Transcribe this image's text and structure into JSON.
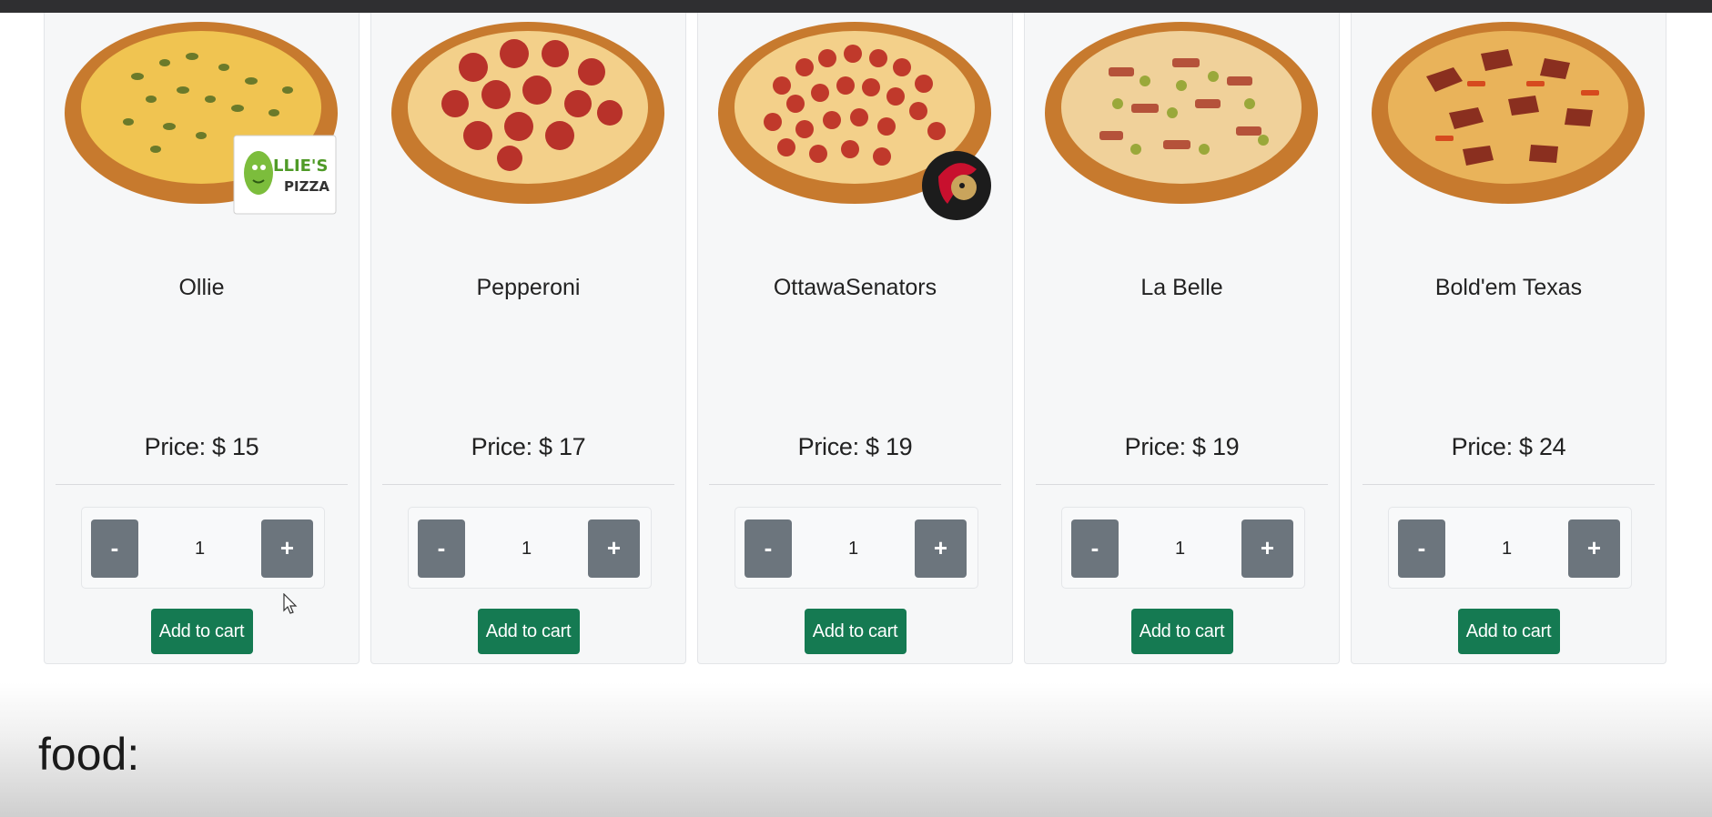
{
  "products": [
    {
      "name": "Ollie",
      "price_label": "Price: $ 15",
      "quantity": "1",
      "minus_label": "-",
      "plus_label": "+",
      "cart_label": "Add to cart",
      "topping": "olive"
    },
    {
      "name": "Pepperoni",
      "price_label": "Price: $ 17",
      "quantity": "1",
      "minus_label": "-",
      "plus_label": "+",
      "cart_label": "Add to cart",
      "topping": "pepperoni"
    },
    {
      "name": "OttawaSenators",
      "price_label": "Price: $ 19",
      "quantity": "1",
      "minus_label": "-",
      "plus_label": "+",
      "cart_label": "Add to cart",
      "topping": "mini-pepperoni"
    },
    {
      "name": "La Belle",
      "price_label": "Price: $ 19",
      "quantity": "1",
      "minus_label": "-",
      "plus_label": "+",
      "cart_label": "Add to cart",
      "topping": "mixed"
    },
    {
      "name": "Bold'em Texas",
      "price_label": "Price: $ 24",
      "quantity": "1",
      "minus_label": "-",
      "plus_label": "+",
      "cart_label": "Add to cart",
      "topping": "meat"
    }
  ],
  "logos": {
    "ollie_text_top": "LLIE'S",
    "ollie_text_bottom": "PIZZA"
  },
  "section": {
    "title": "food:"
  },
  "colors": {
    "cart_button": "#157a52",
    "qty_button": "#6c757d",
    "card_bg": "#f6f7f8"
  }
}
